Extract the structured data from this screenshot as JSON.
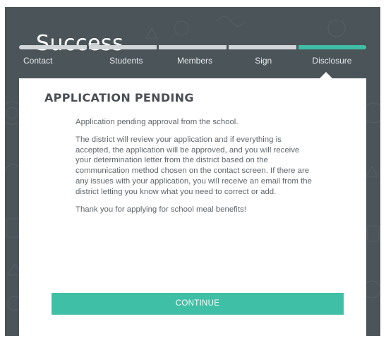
{
  "page": {
    "title": "Success"
  },
  "progress": {
    "active_index": 4,
    "steps": [
      {
        "label": "Contact"
      },
      {
        "label": "Students"
      },
      {
        "label": "Members"
      },
      {
        "label": "Sign"
      },
      {
        "label": "Disclosure"
      }
    ]
  },
  "card": {
    "heading": "APPLICATION PENDING",
    "paragraphs": [
      "Application pending approval from the school.",
      "The district will review your application and if everything is accepted, the application will be approved, and you will receive your determination letter from the district based on the communication method chosen on the contact screen. If there are any issues with your application, you will receive an email from the district letting you know what you need to correct or add.",
      "Thank you for applying for school meal benefits!"
    ],
    "continue_label": "CONTINUE"
  },
  "colors": {
    "background": "#4b5459",
    "accent": "#3fbfa5",
    "card": "#ffffff",
    "heading": "#4a4f54",
    "body_text": "#5f666b"
  }
}
